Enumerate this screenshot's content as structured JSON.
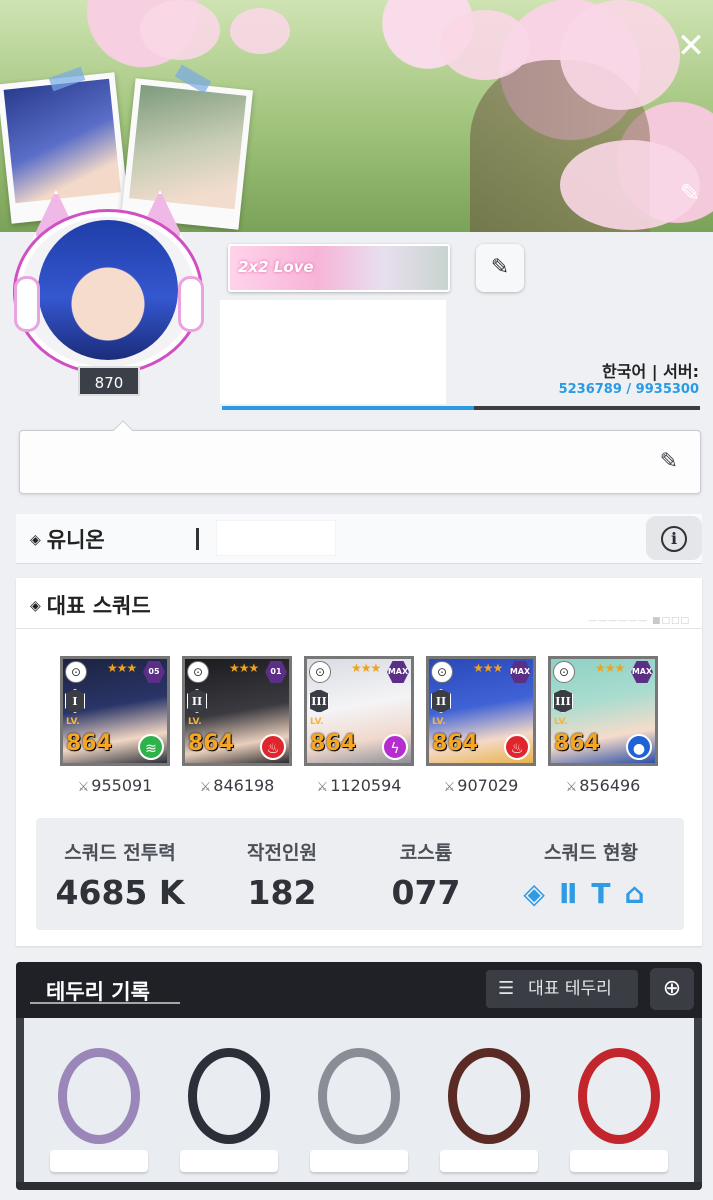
{
  "banner": {
    "close_icon": "close-icon",
    "edit_icon": "edit-icon"
  },
  "profile": {
    "level": "870",
    "tag_badge_text": "2x2 Love",
    "server_text": "한국어 | 서버:",
    "exp_text": "5236789 / 9935300",
    "exp_fraction": 0.527
  },
  "union": {
    "title": "유니온"
  },
  "squad": {
    "title": "대표 스쿼드",
    "cards": [
      {
        "burst": "I",
        "limit": "05",
        "level": "864",
        "power": "955091",
        "element": "wind",
        "element_color": "#2db34a"
      },
      {
        "burst": "II",
        "limit": "01",
        "level": "864",
        "power": "846198",
        "element": "fire",
        "element_color": "#e0262c"
      },
      {
        "burst": "III",
        "limit": "MAX",
        "level": "864",
        "power": "1120594",
        "element": "electric",
        "element_color": "#b52ccf"
      },
      {
        "burst": "II",
        "limit": "MAX",
        "level": "864",
        "power": "907029",
        "element": "fire",
        "element_color": "#e0262c"
      },
      {
        "burst": "III",
        "limit": "MAX",
        "level": "864",
        "power": "856496",
        "element": "water",
        "element_color": "#1f62d6"
      }
    ],
    "stats": {
      "power_label": "스쿼드 전투력",
      "power_value": "4685 K",
      "personnel_label": "작전인원",
      "personnel_value": "182",
      "costume_label": "코스튬",
      "costume_value": "077",
      "status_label": "스쿼드 현황"
    }
  },
  "tetdoory": {
    "title": "테두리 기록",
    "rep_button_label": "대표 테두리",
    "ring_colors": [
      "#9a86b8",
      "#2c2f38",
      "#8a8d96",
      "#5b2a24",
      "#c2262c"
    ]
  }
}
